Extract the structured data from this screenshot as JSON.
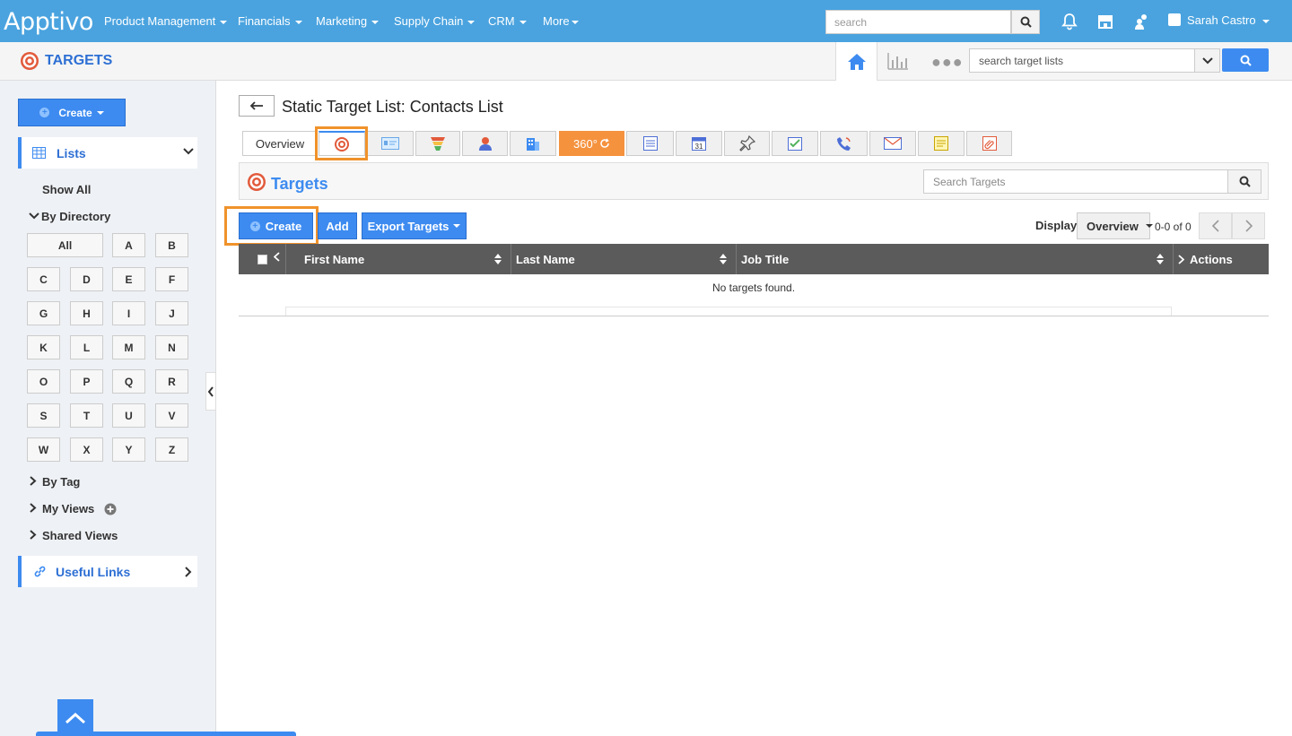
{
  "topnav": {
    "logo": "Apptivo",
    "menus": [
      "Product Management",
      "Financials",
      "Marketing",
      "Supply Chain",
      "CRM",
      "More"
    ],
    "search_placeholder": "search",
    "user_name": "Sarah Castro"
  },
  "subbar": {
    "app_title": "TARGETS",
    "target_list_search": "search target lists"
  },
  "sidebar": {
    "create_label": "Create",
    "lists_label": "Lists",
    "show_all": "Show All",
    "by_directory": "By Directory",
    "letters": [
      "All",
      "A",
      "B",
      "C",
      "D",
      "E",
      "F",
      "G",
      "H",
      "I",
      "J",
      "K",
      "L",
      "M",
      "N",
      "O",
      "P",
      "Q",
      "R",
      "S",
      "T",
      "U",
      "V",
      "W",
      "X",
      "Y",
      "Z"
    ],
    "by_tag": "By Tag",
    "my_views": "My Views",
    "shared_views": "Shared Views",
    "useful_links": "Useful Links"
  },
  "main": {
    "page_title": "Static Target List: Contacts List",
    "tabs": {
      "overview": "Overview",
      "c360": "360°",
      "calendar_day": "31"
    },
    "panel_title": "Targets",
    "search_targets_placeholder": "Search Targets",
    "actions": {
      "create": "Create",
      "add": "Add",
      "export": "Export Targets"
    },
    "display_label": "Display",
    "display_value": "Overview",
    "pagination": "0-0 of 0",
    "table": {
      "columns": [
        "First Name",
        "Last Name",
        "Job Title",
        "Actions"
      ],
      "empty_message": "No targets found."
    }
  },
  "colors": {
    "nav_blue": "#4aa3df",
    "accent_blue": "#3d8bf0",
    "highlight_orange": "#f0922b",
    "tab_360_orange": "#f5923e"
  }
}
